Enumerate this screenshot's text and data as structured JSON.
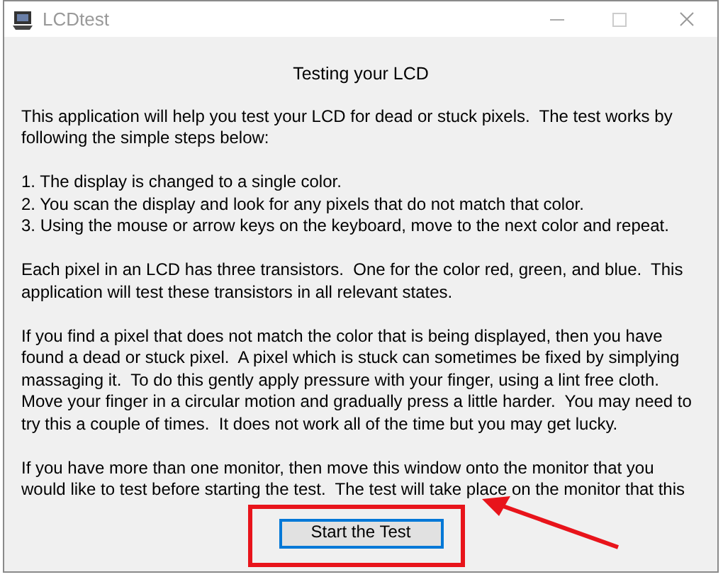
{
  "window": {
    "title": "LCDtest"
  },
  "heading": "Testing your LCD",
  "paragraphs": [
    {
      "lines": [
        "This application will help you test your LCD for dead or stuck pixels.  The test works by",
        "following the simple steps below:"
      ]
    },
    {
      "lines": [
        "1. The display is changed to a single color.",
        "2. You scan the display and look for any pixels that do not match that color.",
        "3. Using the mouse or arrow keys on the keyboard, move to the next color and repeat."
      ]
    },
    {
      "lines": [
        "Each pixel in an LCD has three transistors.  One for the color red, green, and blue.  This",
        "application will test these transistors in all relevant states."
      ]
    },
    {
      "lines": [
        "If you find a pixel that does not match the color that is being displayed, then you have",
        "found a dead or stuck pixel.  A pixel which is stuck can sometimes be fixed by simplying",
        "massaging it.  To do this gently apply pressure with your finger, using a lint free cloth.",
        "Move your finger in a circular motion and gradually press a little harder.  You may need to",
        "try this a couple of times.  It does not work all of the time but you may get lucky."
      ]
    },
    {
      "lines": [
        "If you have more than one monitor, then move this window onto the monitor that you",
        "would like to test before starting the test.  The test will take place on the monitor that this"
      ]
    }
  ],
  "start_button": {
    "label": "Start the Test"
  }
}
